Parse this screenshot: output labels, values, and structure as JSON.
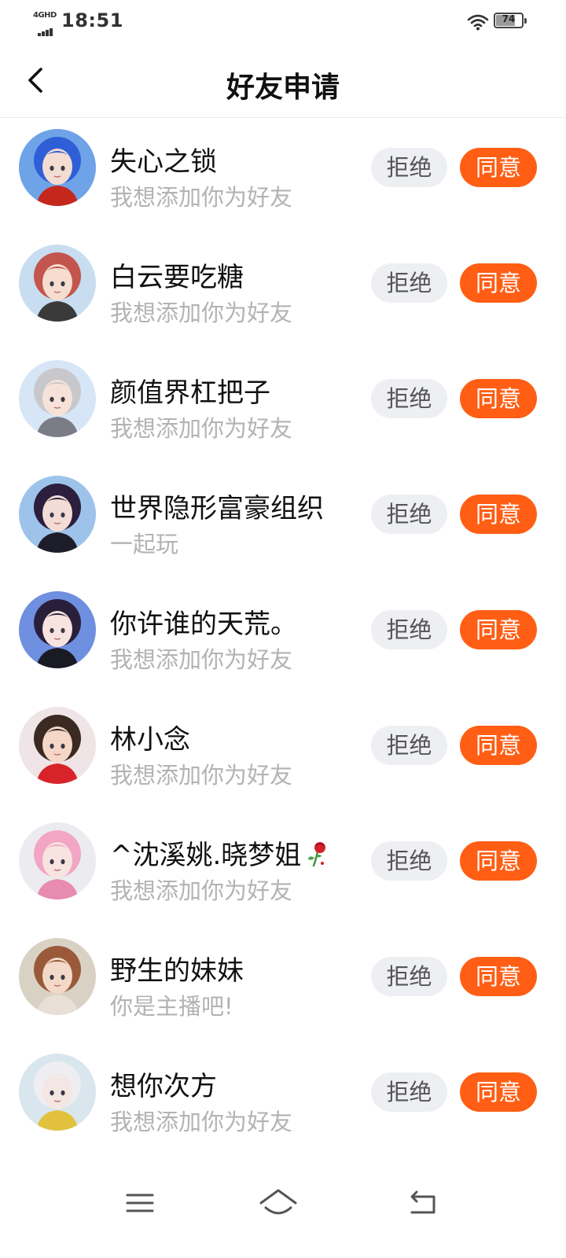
{
  "status_bar": {
    "network": "4GHD",
    "time": "18:51",
    "battery_level": "74",
    "battery_fraction": 0.74
  },
  "header": {
    "title": "好友申请",
    "back_icon": "chevron-left-icon"
  },
  "requests": [
    {
      "name": "失心之锁",
      "message": "我想添加你为好友",
      "reject_label": "拒绝",
      "accept_label": "同意",
      "avatar": {
        "bg": "#6fa3e8",
        "hair": "#2f5fd6",
        "skin": "#f3dcd2",
        "accent": "#c4281c"
      }
    },
    {
      "name": "白云要吃糖",
      "message": "我想添加你为好友",
      "reject_label": "拒绝",
      "accept_label": "同意",
      "avatar": {
        "bg": "#c9ddf0",
        "hair": "#c2554d",
        "skin": "#f6ddcf",
        "accent": "#3a3a3a"
      }
    },
    {
      "name": "颜值界杠把子",
      "message": "我想添加你为好友",
      "reject_label": "拒绝",
      "accept_label": "同意",
      "avatar": {
        "bg": "#d7e6f6",
        "hair": "#c8c8cc",
        "skin": "#f6e2d8",
        "accent": "#7a7d86"
      }
    },
    {
      "name": "世界隐形富豪组织",
      "message": "一起玩",
      "reject_label": "拒绝",
      "accept_label": "同意",
      "avatar": {
        "bg": "#9ec3ea",
        "hair": "#2b1f3d",
        "skin": "#f4dcd6",
        "accent": "#1d1d2a"
      }
    },
    {
      "name": "你许谁的天荒。",
      "message": "我想添加你为好友",
      "reject_label": "拒绝",
      "accept_label": "同意",
      "avatar": {
        "bg": "#6f8fe0",
        "hair": "#2a1f3a",
        "skin": "#f7e3df",
        "accent": "#1a1a24"
      }
    },
    {
      "name": "林小念",
      "message": "我想添加你为好友",
      "reject_label": "拒绝",
      "accept_label": "同意",
      "avatar": {
        "bg": "#efe4e6",
        "hair": "#3a2a22",
        "skin": "#f5d7c7",
        "accent": "#d8232a"
      }
    },
    {
      "name": "^沈溪姚.晓梦姐",
      "message": "我想添加你为好友",
      "reject_label": "拒绝",
      "accept_label": "同意",
      "emoji": "rose-icon",
      "avatar": {
        "bg": "#ececf0",
        "hair": "#f2a6c4",
        "skin": "#f7e4e0",
        "accent": "#e88bb0"
      }
    },
    {
      "name": "野生的妹妹",
      "message": "你是主播吧!",
      "reject_label": "拒绝",
      "accept_label": "同意",
      "avatar": {
        "bg": "#d9d2c4",
        "hair": "#9a5a3a",
        "skin": "#f3d9c8",
        "accent": "#e8e0d6"
      }
    },
    {
      "name": "想你次方",
      "message": "我想添加你为好友",
      "reject_label": "拒绝",
      "accept_label": "同意",
      "avatar": {
        "bg": "#d9e6ee",
        "hair": "#eeeef2",
        "skin": "#f4e6e2",
        "accent": "#e2c23c"
      }
    }
  ],
  "nav_bar": {
    "menu_icon": "menu-icon",
    "home_icon": "home-icon",
    "back_icon": "return-icon"
  },
  "colors": {
    "accept": "#ff5e14",
    "reject_bg": "#eeeff3",
    "message_text": "#b3b3b3"
  }
}
